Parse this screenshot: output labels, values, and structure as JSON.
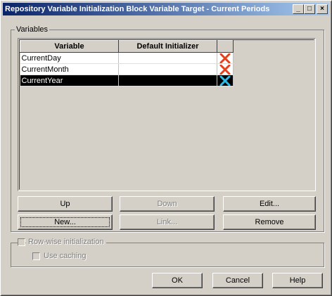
{
  "window": {
    "title": "Repository Variable Initialization Block Variable Target - Current Periods",
    "controls": {
      "minimize": "_",
      "maximize": "□",
      "close": "×"
    }
  },
  "variables_group": {
    "label": "Variables",
    "columns": [
      "Variable",
      "Default Initializer",
      ""
    ],
    "rows": [
      {
        "variable": "CurrentDay",
        "initializer": "",
        "selected": false
      },
      {
        "variable": "CurrentMonth",
        "initializer": "",
        "selected": false
      },
      {
        "variable": "CurrentYear",
        "initializer": "",
        "selected": true
      }
    ],
    "buttons": {
      "up": "Up",
      "down": "Down",
      "edit": "Edit...",
      "new": "New...",
      "link": "Link...",
      "remove": "Remove"
    }
  },
  "rowwise": {
    "label": "Row-wise initialization",
    "use_caching": "Use caching"
  },
  "footer": {
    "ok": "OK",
    "cancel": "Cancel",
    "help": "Help"
  },
  "colors": {
    "delete_icon": "#e8401c",
    "delete_icon_selected": "#2fb8e8"
  }
}
